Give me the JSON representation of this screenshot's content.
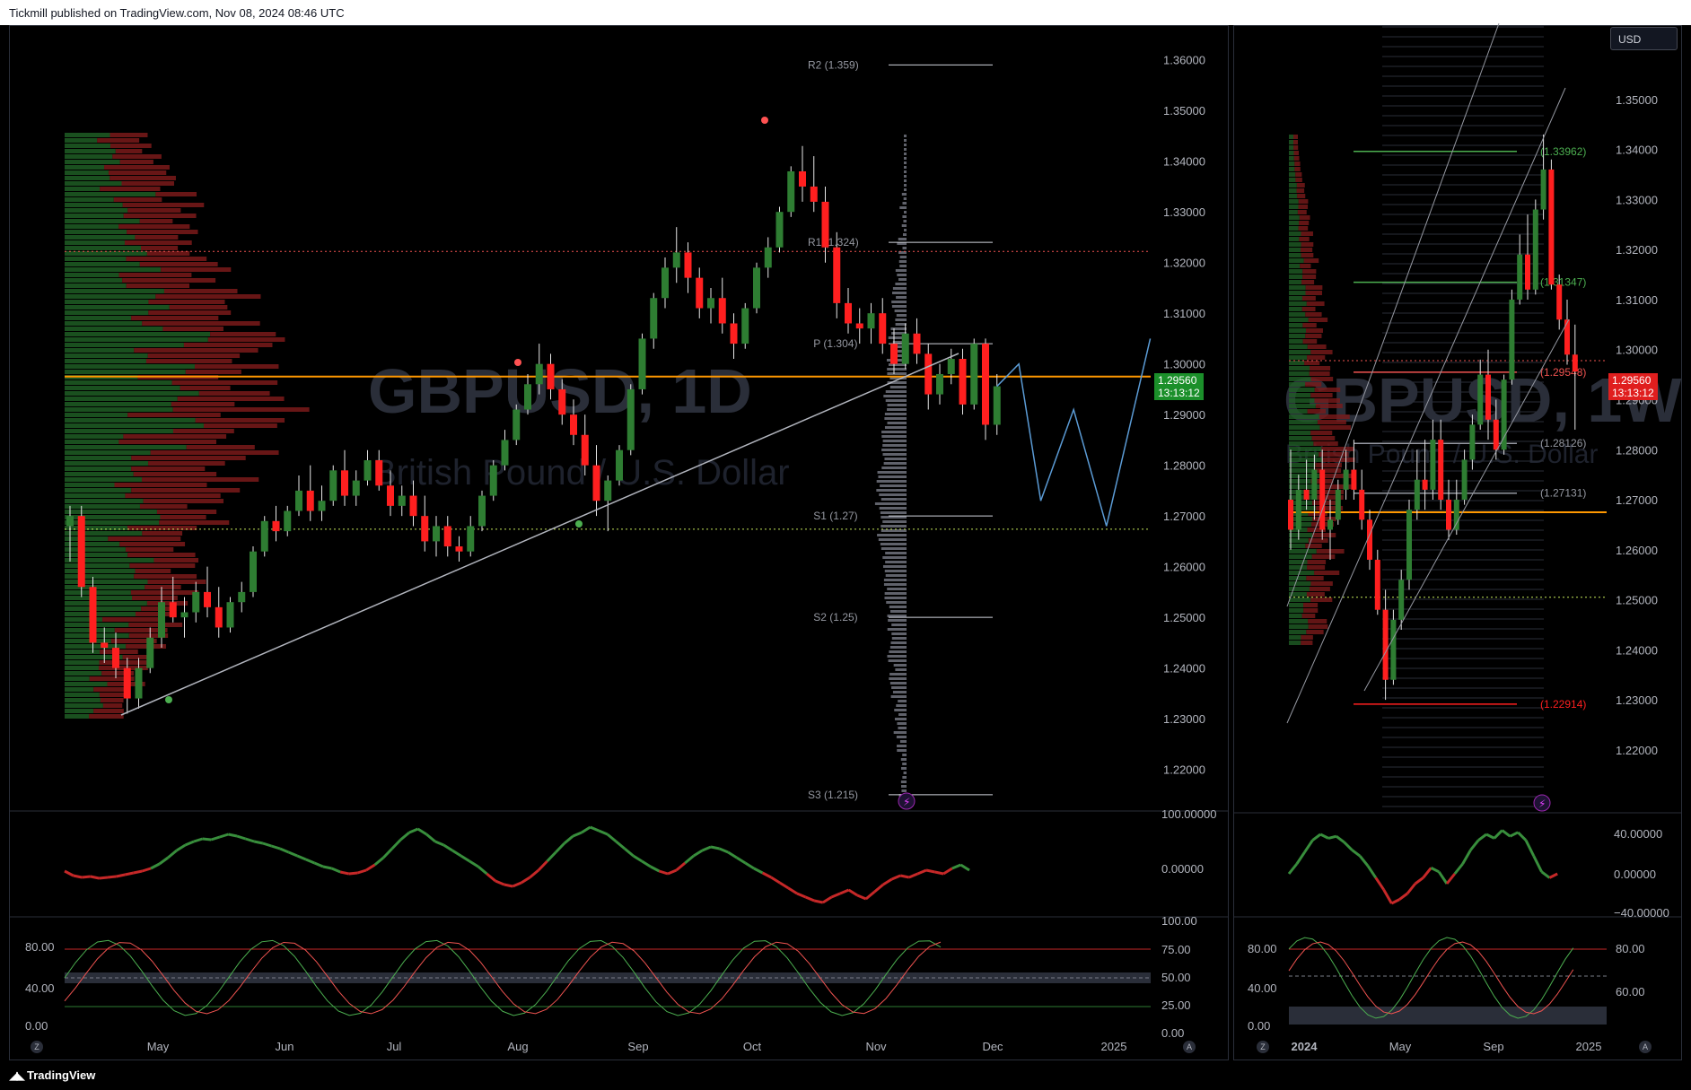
{
  "header": {
    "publisher_text": "Tickmill published on TradingView.com, Nov 08, 2024 08:46 UTC"
  },
  "footer": {
    "brand": "TradingView",
    "brand_icon": "tradingview-logo-icon"
  },
  "currency_button": {
    "label": "USD"
  },
  "corner_buttons": {
    "z": "Z",
    "a": "A"
  },
  "colors": {
    "bull": "#2e7d32",
    "bear": "#ff1f1f",
    "pivot_line": "#d1d4dc",
    "poc": "#ff9800",
    "projection": "#5b9bd5"
  },
  "chart_data": [
    {
      "type": "candlestick",
      "title": "GBPUSD, 1D",
      "subtitle": "British Pound / U.S. Dollar",
      "x_labels": [
        "May",
        "Jun",
        "Jul",
        "Aug",
        "Sep",
        "Oct",
        "Nov",
        "Dec",
        "2025"
      ],
      "y_ticks": [
        "1.36000",
        "1.35000",
        "1.34000",
        "1.33000",
        "1.32000",
        "1.31000",
        "1.30000",
        "1.29000",
        "1.28000",
        "1.27000",
        "1.26000",
        "1.25000",
        "1.24000",
        "1.23000",
        "1.22000"
      ],
      "ylim": [
        1.2125,
        1.3665
      ],
      "last_price": {
        "value": "1.29560",
        "countdown": "13:13:12"
      },
      "pivots": [
        {
          "label": "R2 (1.359)",
          "value": 1.359
        },
        {
          "label": "R1 (1.324)",
          "value": 1.324
        },
        {
          "label": "P (1.304)",
          "value": 1.304
        },
        {
          "label": "S1 (1.27)",
          "value": 1.27
        },
        {
          "label": "S2 (1.25)",
          "value": 1.25
        },
        {
          "label": "S3 (1.215)",
          "value": 1.215
        }
      ],
      "levels": {
        "poc": 1.2975,
        "red_dotted": 1.3222,
        "green_dotted": 1.2674
      },
      "candles": [
        [
          1.268,
          1.272,
          1.261,
          1.27
        ],
        [
          1.27,
          1.272,
          1.254,
          1.256
        ],
        [
          1.256,
          1.258,
          1.243,
          1.245
        ],
        [
          1.245,
          1.248,
          1.241,
          1.244
        ],
        [
          1.244,
          1.247,
          1.238,
          1.24
        ],
        [
          1.24,
          1.242,
          1.231,
          1.234
        ],
        [
          1.234,
          1.242,
          1.232,
          1.24
        ],
        [
          1.24,
          1.248,
          1.239,
          1.246
        ],
        [
          1.246,
          1.256,
          1.244,
          1.253
        ],
        [
          1.253,
          1.258,
          1.249,
          1.25
        ],
        [
          1.25,
          1.254,
          1.246,
          1.251
        ],
        [
          1.251,
          1.257,
          1.249,
          1.255
        ],
        [
          1.255,
          1.26,
          1.25,
          1.252
        ],
        [
          1.252,
          1.256,
          1.246,
          1.248
        ],
        [
          1.248,
          1.254,
          1.247,
          1.253
        ],
        [
          1.253,
          1.257,
          1.251,
          1.255
        ],
        [
          1.255,
          1.264,
          1.254,
          1.263
        ],
        [
          1.263,
          1.27,
          1.262,
          1.269
        ],
        [
          1.269,
          1.272,
          1.265,
          1.267
        ],
        [
          1.267,
          1.272,
          1.266,
          1.271
        ],
        [
          1.271,
          1.278,
          1.27,
          1.275
        ],
        [
          1.275,
          1.28,
          1.269,
          1.271
        ],
        [
          1.271,
          1.276,
          1.269,
          1.273
        ],
        [
          1.273,
          1.28,
          1.272,
          1.279
        ],
        [
          1.279,
          1.283,
          1.272,
          1.274
        ],
        [
          1.274,
          1.279,
          1.272,
          1.277
        ],
        [
          1.277,
          1.283,
          1.276,
          1.281
        ],
        [
          1.281,
          1.283,
          1.275,
          1.276
        ],
        [
          1.276,
          1.279,
          1.27,
          1.272
        ],
        [
          1.272,
          1.276,
          1.27,
          1.274
        ],
        [
          1.274,
          1.277,
          1.268,
          1.27
        ],
        [
          1.27,
          1.274,
          1.263,
          1.265
        ],
        [
          1.265,
          1.27,
          1.262,
          1.268
        ],
        [
          1.268,
          1.27,
          1.262,
          1.264
        ],
        [
          1.264,
          1.266,
          1.261,
          1.263
        ],
        [
          1.263,
          1.27,
          1.262,
          1.268
        ],
        [
          1.268,
          1.275,
          1.267,
          1.274
        ],
        [
          1.274,
          1.281,
          1.273,
          1.28
        ],
        [
          1.28,
          1.287,
          1.279,
          1.285
        ],
        [
          1.285,
          1.292,
          1.284,
          1.291
        ],
        [
          1.291,
          1.298,
          1.29,
          1.296
        ],
        [
          1.296,
          1.304,
          1.294,
          1.3
        ],
        [
          1.3,
          1.302,
          1.293,
          1.295
        ],
        [
          1.295,
          1.297,
          1.288,
          1.29
        ],
        [
          1.29,
          1.293,
          1.284,
          1.286
        ],
        [
          1.286,
          1.29,
          1.278,
          1.28
        ],
        [
          1.28,
          1.284,
          1.27,
          1.273
        ],
        [
          1.273,
          1.278,
          1.267,
          1.277
        ],
        [
          1.277,
          1.284,
          1.276,
          1.283
        ],
        [
          1.283,
          1.296,
          1.282,
          1.295
        ],
        [
          1.295,
          1.306,
          1.294,
          1.305
        ],
        [
          1.305,
          1.314,
          1.303,
          1.313
        ],
        [
          1.313,
          1.321,
          1.311,
          1.319
        ],
        [
          1.319,
          1.327,
          1.316,
          1.322
        ],
        [
          1.322,
          1.324,
          1.314,
          1.317
        ],
        [
          1.317,
          1.319,
          1.309,
          1.311
        ],
        [
          1.311,
          1.315,
          1.308,
          1.313
        ],
        [
          1.313,
          1.317,
          1.306,
          1.308
        ],
        [
          1.308,
          1.31,
          1.301,
          1.304
        ],
        [
          1.304,
          1.312,
          1.303,
          1.311
        ],
        [
          1.311,
          1.32,
          1.31,
          1.319
        ],
        [
          1.319,
          1.325,
          1.317,
          1.323
        ],
        [
          1.323,
          1.331,
          1.322,
          1.33
        ],
        [
          1.33,
          1.339,
          1.329,
          1.338
        ],
        [
          1.338,
          1.343,
          1.332,
          1.335
        ],
        [
          1.335,
          1.341,
          1.33,
          1.332
        ],
        [
          1.332,
          1.335,
          1.32,
          1.323
        ],
        [
          1.323,
          1.326,
          1.309,
          1.312
        ],
        [
          1.312,
          1.315,
          1.306,
          1.308
        ],
        [
          1.308,
          1.311,
          1.304,
          1.307
        ],
        [
          1.307,
          1.312,
          1.304,
          1.31
        ],
        [
          1.31,
          1.313,
          1.302,
          1.304
        ],
        [
          1.304,
          1.307,
          1.298,
          1.3
        ],
        [
          1.3,
          1.308,
          1.299,
          1.306
        ],
        [
          1.306,
          1.309,
          1.3,
          1.302
        ],
        [
          1.302,
          1.304,
          1.291,
          1.294
        ],
        [
          1.294,
          1.3,
          1.292,
          1.298
        ],
        [
          1.298,
          1.303,
          1.296,
          1.301
        ],
        [
          1.301,
          1.303,
          1.29,
          1.292
        ],
        [
          1.292,
          1.305,
          1.291,
          1.304
        ],
        [
          1.304,
          1.305,
          1.285,
          1.288
        ],
        [
          1.288,
          1.298,
          1.286,
          1.2956
        ]
      ],
      "projection_path": [
        [
          1.2956,
          0
        ],
        [
          1.3,
          2
        ],
        [
          1.273,
          4
        ],
        [
          1.291,
          7
        ],
        [
          1.268,
          10
        ],
        [
          1.305,
          14
        ]
      ]
    },
    {
      "type": "candlestick",
      "title": "GBPUSD, 1W",
      "subtitle": "British Pound / U.S. Dollar",
      "x_labels": [
        "2024",
        "May",
        "Sep",
        "2025"
      ],
      "y_ticks": [
        "1.35000",
        "1.34000",
        "1.33000",
        "1.32000",
        "1.31000",
        "1.30000",
        "1.29000",
        "1.28000",
        "1.27000",
        "1.26000",
        "1.25000",
        "1.24000",
        "1.23000",
        "1.22000"
      ],
      "ylim": [
        1.2085,
        1.3645
      ],
      "last_price": {
        "value": "1.29560",
        "countdown": "13:13:12"
      },
      "level_labels": [
        {
          "label": "1.33962",
          "value": 1.33962,
          "color": "#4caf50"
        },
        {
          "label": "1.31347",
          "value": 1.31347,
          "color": "#4caf50"
        },
        {
          "label": "1.29548",
          "value": 1.29548,
          "color": "#ef5350"
        },
        {
          "label": "1.28126",
          "value": 1.28126,
          "color": "#9598a1"
        },
        {
          "label": "1.27131",
          "value": 1.27131,
          "color": "#9598a1"
        },
        {
          "label": "1.22914",
          "value": 1.22914,
          "color": "#ff1f1f"
        }
      ],
      "candles": [
        [
          1.27,
          1.28,
          1.26,
          1.264
        ],
        [
          1.264,
          1.275,
          1.262,
          1.272
        ],
        [
          1.272,
          1.278,
          1.268,
          1.27
        ],
        [
          1.27,
          1.279,
          1.266,
          1.276
        ],
        [
          1.276,
          1.28,
          1.262,
          1.264
        ],
        [
          1.264,
          1.27,
          1.258,
          1.266
        ],
        [
          1.266,
          1.274,
          1.265,
          1.272
        ],
        [
          1.272,
          1.28,
          1.27,
          1.276
        ],
        [
          1.276,
          1.282,
          1.27,
          1.272
        ],
        [
          1.272,
          1.276,
          1.264,
          1.266
        ],
        [
          1.266,
          1.268,
          1.256,
          1.258
        ],
        [
          1.258,
          1.26,
          1.247,
          1.248
        ],
        [
          1.248,
          1.252,
          1.23,
          1.234
        ],
        [
          1.234,
          1.248,
          1.233,
          1.246
        ],
        [
          1.246,
          1.256,
          1.244,
          1.254
        ],
        [
          1.254,
          1.27,
          1.252,
          1.268
        ],
        [
          1.268,
          1.28,
          1.266,
          1.274
        ],
        [
          1.274,
          1.282,
          1.268,
          1.272
        ],
        [
          1.272,
          1.286,
          1.27,
          1.282
        ],
        [
          1.282,
          1.286,
          1.268,
          1.27
        ],
        [
          1.27,
          1.274,
          1.262,
          1.264
        ],
        [
          1.264,
          1.274,
          1.263,
          1.27
        ],
        [
          1.27,
          1.28,
          1.269,
          1.278
        ],
        [
          1.278,
          1.287,
          1.276,
          1.285
        ],
        [
          1.285,
          1.298,
          1.284,
          1.295
        ],
        [
          1.295,
          1.3,
          1.282,
          1.286
        ],
        [
          1.286,
          1.29,
          1.278,
          1.28
        ],
        [
          1.28,
          1.295,
          1.279,
          1.294
        ],
        [
          1.294,
          1.312,
          1.293,
          1.31
        ],
        [
          1.31,
          1.323,
          1.309,
          1.319
        ],
        [
          1.319,
          1.327,
          1.31,
          1.312
        ],
        [
          1.312,
          1.33,
          1.311,
          1.328
        ],
        [
          1.328,
          1.343,
          1.326,
          1.336
        ],
        [
          1.336,
          1.338,
          1.312,
          1.313
        ],
        [
          1.313,
          1.315,
          1.304,
          1.306
        ],
        [
          1.306,
          1.31,
          1.297,
          1.299
        ],
        [
          1.299,
          1.305,
          1.284,
          1.2956
        ]
      ]
    }
  ],
  "indicators": {
    "left_osc": {
      "ticks": [
        "100.00000",
        "0.00000"
      ],
      "values": [
        -3,
        -8,
        -10,
        -9,
        -11,
        -10,
        -9,
        -7,
        -5,
        -3,
        0,
        5,
        12,
        20,
        26,
        30,
        33,
        32,
        35,
        38,
        36,
        33,
        30,
        28,
        25,
        22,
        18,
        14,
        10,
        6,
        2,
        0,
        -4,
        -6,
        -5,
        -2,
        4,
        12,
        22,
        32,
        40,
        44,
        38,
        30,
        26,
        20,
        14,
        8,
        2,
        -6,
        -14,
        -18,
        -20,
        -16,
        -10,
        -2,
        8,
        18,
        28,
        36,
        40,
        46,
        42,
        38,
        30,
        22,
        14,
        8,
        2,
        -3,
        -6,
        -2,
        6,
        14,
        20,
        24,
        22,
        18,
        12,
        6,
        0,
        -5,
        -10,
        -16,
        -22,
        -28,
        -32,
        -36,
        -38,
        -32,
        -28,
        -24,
        -30,
        -34,
        -26,
        -18,
        -12,
        -8,
        -10,
        -6,
        -2,
        -4,
        -6,
        0,
        4,
        -2
      ]
    },
    "right_osc": {
      "ticks": [
        "40.00000",
        "0.00000",
        "−40.00000"
      ],
      "values": [
        0,
        10,
        22,
        34,
        40,
        36,
        38,
        32,
        24,
        18,
        8,
        -4,
        -16,
        -30,
        -26,
        -20,
        -10,
        -4,
        6,
        2,
        -10,
        0,
        10,
        24,
        34,
        40,
        36,
        44,
        38,
        42,
        34,
        18,
        2,
        -4,
        0
      ]
    },
    "left_stoch": {
      "ticks_left": [
        "80.00",
        "40.00",
        "0.00"
      ],
      "ticks_right": [
        "100.00",
        "75.00",
        "50.00",
        "25.00",
        "0.00"
      ]
    },
    "right_stoch": {
      "ticks_left": [
        "80.00",
        "40.00",
        "0.00"
      ],
      "ticks_right": [
        "80.00",
        "60.00"
      ]
    }
  }
}
